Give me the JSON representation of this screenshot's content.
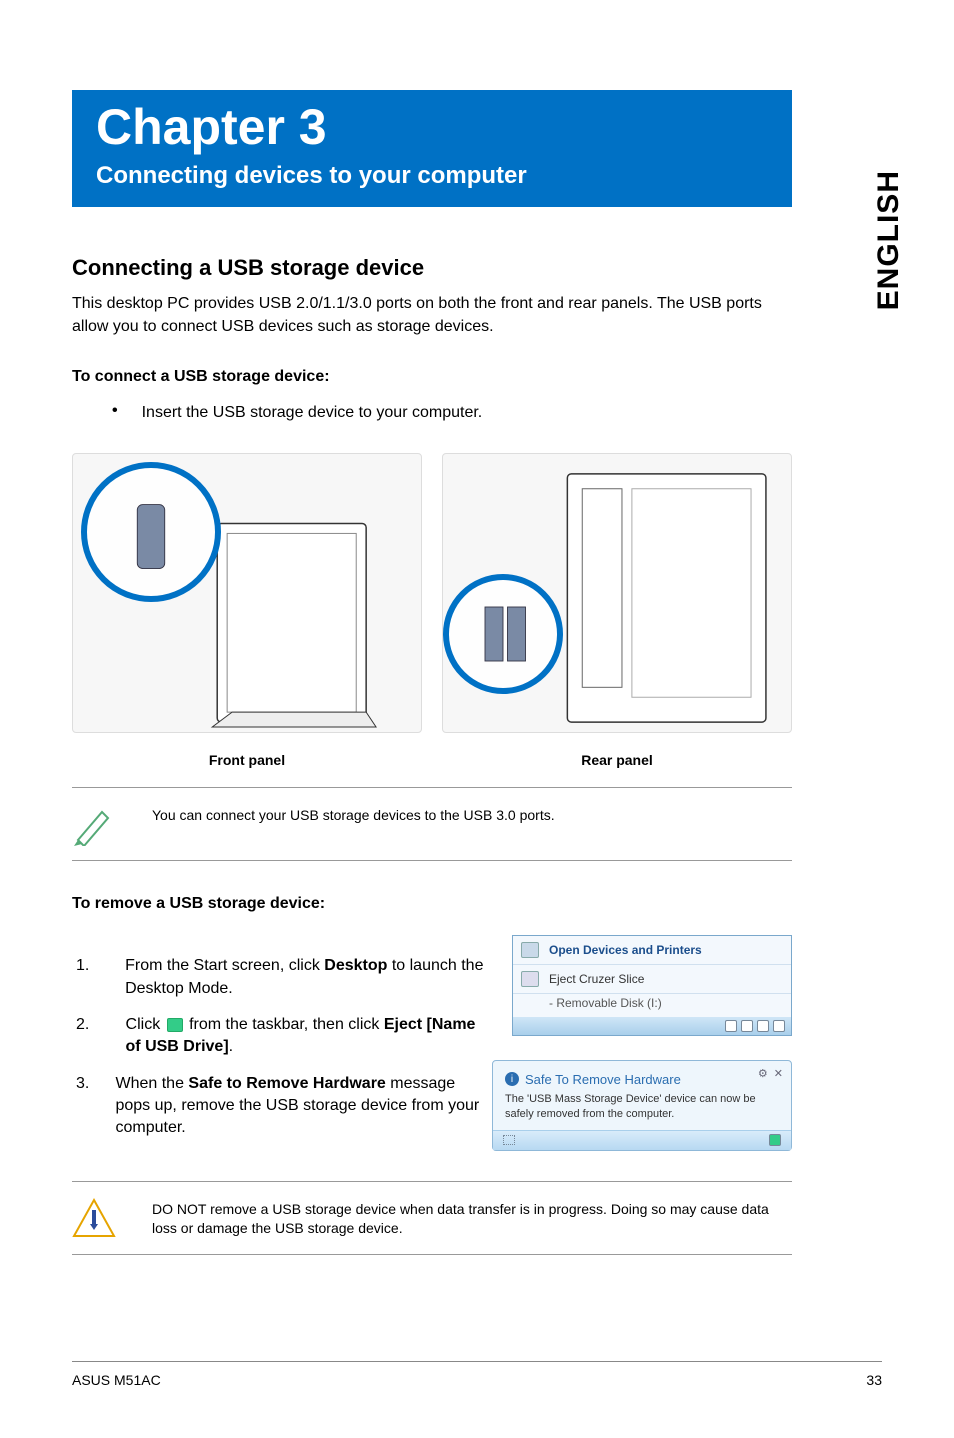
{
  "side_tab": "ENGLISH",
  "chapter": {
    "title": "Chapter 3",
    "subtitle": "Connecting devices to your computer"
  },
  "section1": {
    "heading": "Connecting a USB storage device",
    "intro": "This desktop PC provides USB 2.0/1.1/3.0 ports on both the front and rear panels. The USB ports allow you to connect USB devices such as storage devices.",
    "connect_h": "To connect a USB storage device:",
    "connect_bullet": "Insert the USB storage device to your computer.",
    "front_label": "Front panel",
    "rear_label": "Rear panel",
    "tip": "You can connect your USB storage devices to the USB 3.0 ports."
  },
  "section2": {
    "heading": "To remove a USB storage device:",
    "steps": [
      {
        "num": "1.",
        "pre": "From the Start screen, click ",
        "bold": "Desktop",
        "post": " to launch the Desktop Mode."
      },
      {
        "num": "2.",
        "pre": "Click ",
        "mid": " from the taskbar, then click ",
        "bold": "Eject [Name of USB Drive]",
        "post": "."
      },
      {
        "num": "3.",
        "pre": "When the ",
        "bold": "Safe to Remove Hardware",
        "post": " message pops up, remove the USB storage device from your computer."
      }
    ]
  },
  "popup1": {
    "open_devices": "Open Devices and Printers",
    "eject": "Eject Cruzer Slice",
    "removable": "-   Removable Disk (I:)"
  },
  "popup2": {
    "title": "Safe To Remove Hardware",
    "body": "The 'USB Mass Storage Device' device can now be safely removed from the computer."
  },
  "warning": "DO NOT remove a USB storage device when data transfer is in progress. Doing so may cause data loss or damage the USB storage device.",
  "footer": {
    "left": "ASUS M51AC",
    "right": "33"
  }
}
